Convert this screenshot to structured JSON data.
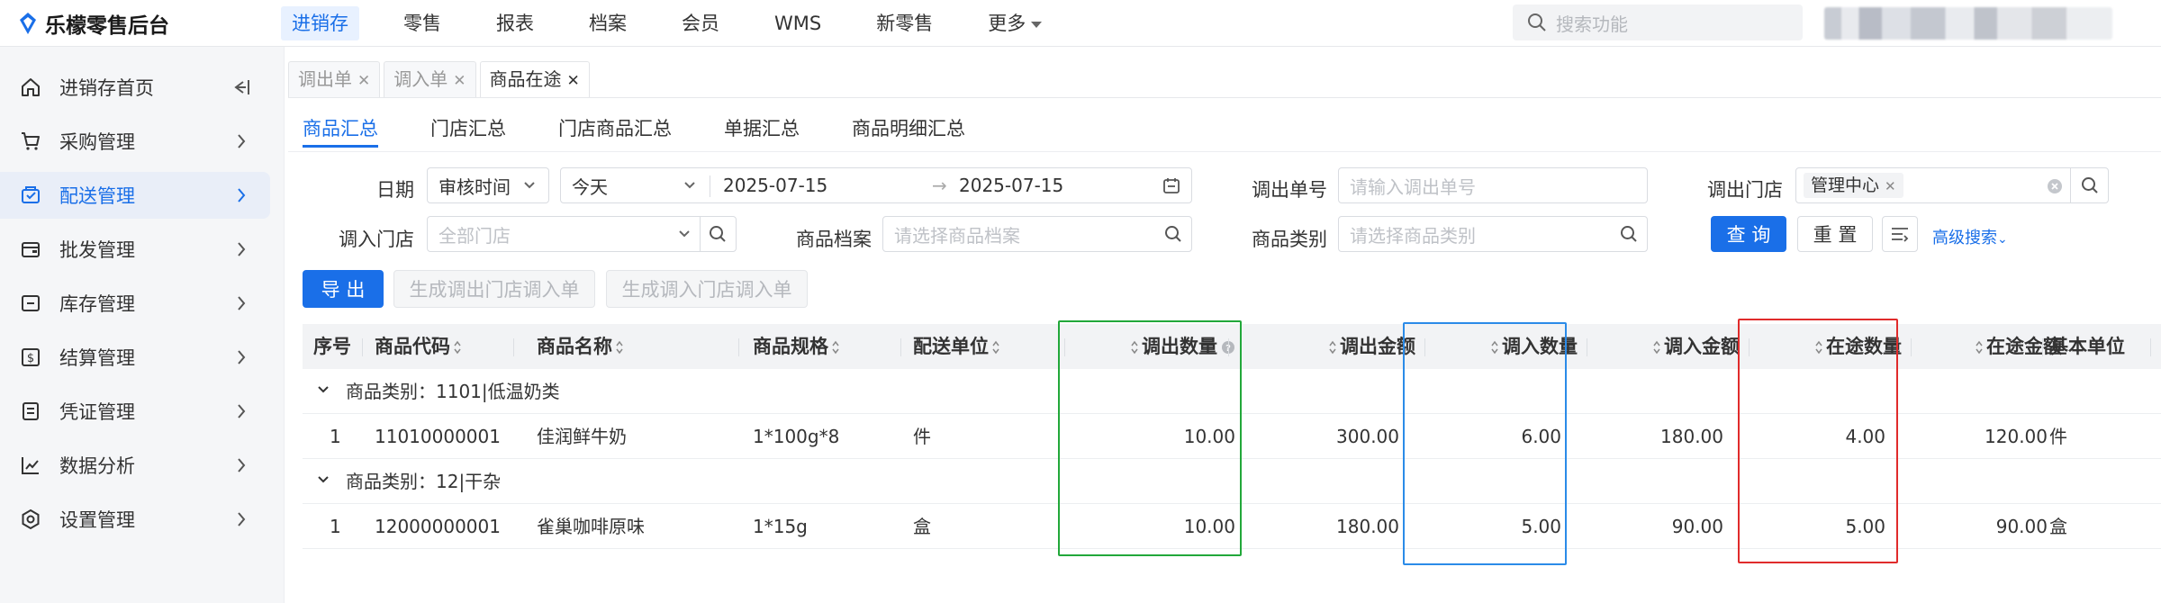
{
  "app": {
    "title": "乐檬零售后台",
    "brand_color": "#1a6fe8"
  },
  "topnav": {
    "items": [
      {
        "label": "进销存",
        "active": true
      },
      {
        "label": "零售"
      },
      {
        "label": "报表"
      },
      {
        "label": "档案"
      },
      {
        "label": "会员"
      },
      {
        "label": "WMS"
      },
      {
        "label": "新零售"
      },
      {
        "label": "更多"
      }
    ],
    "search_placeholder": "搜索功能"
  },
  "sidebar": {
    "items": [
      {
        "label": "进销存首页",
        "icon": "home-icon"
      },
      {
        "label": "采购管理",
        "icon": "cart-icon"
      },
      {
        "label": "配送管理",
        "icon": "delivery-icon",
        "active": true
      },
      {
        "label": "批发管理",
        "icon": "wallet-icon"
      },
      {
        "label": "库存管理",
        "icon": "inventory-icon"
      },
      {
        "label": "结算管理",
        "icon": "settlement-icon"
      },
      {
        "label": "凭证管理",
        "icon": "voucher-icon"
      },
      {
        "label": "数据分析",
        "icon": "chart-icon"
      },
      {
        "label": "设置管理",
        "icon": "settings-icon"
      }
    ]
  },
  "page_tabs": [
    {
      "label": "调出单",
      "active": false
    },
    {
      "label": "调入单",
      "active": false
    },
    {
      "label": "商品在途",
      "active": true
    }
  ],
  "sub_tabs": [
    {
      "label": "商品汇总",
      "active": true
    },
    {
      "label": "门店汇总"
    },
    {
      "label": "门店商品汇总"
    },
    {
      "label": "单据汇总"
    },
    {
      "label": "商品明细汇总"
    }
  ],
  "filters": {
    "date_label": "日期",
    "date_type": "审核时间",
    "date_range": "今天",
    "date_from": "2025-07-15",
    "date_to": "2025-07-15",
    "out_order_label": "调出单号",
    "out_order_placeholder": "请输入调出单号",
    "out_store_label": "调出门店",
    "out_store_tag": "管理中心",
    "in_store_label": "调入门店",
    "in_store_placeholder": "全部门店",
    "product_label": "商品档案",
    "product_placeholder": "请选择商品档案",
    "category_label": "商品类别",
    "category_placeholder": "请选择商品类别",
    "query_button": "查 询",
    "reset_button": "重 置",
    "advanced_link": "高级搜索"
  },
  "actions": {
    "export": "导 出",
    "gen_out": "生成调出门店调入单",
    "gen_in": "生成调入门店调入单"
  },
  "table": {
    "columns": [
      "序号",
      "商品代码",
      "商品名称",
      "商品规格",
      "配送单位",
      "调出数量",
      "调出金额",
      "调入数量",
      "调入金额",
      "在途数量",
      "在途金额",
      "基本单位"
    ],
    "groups": [
      {
        "label": "商品类别：1101|低温奶类",
        "rows": [
          {
            "no": "1",
            "code": "11010000001",
            "name": "佳润鲜牛奶",
            "spec": "1*100g*8",
            "unit": "件",
            "out_qty": "10.00",
            "out_amt": "300.00",
            "in_qty": "6.00",
            "in_amt": "180.00",
            "transit_qty": "4.00",
            "transit_amt": "120.00",
            "base_unit": "件"
          }
        ]
      },
      {
        "label": "商品类别：12|干杂",
        "rows": [
          {
            "no": "1",
            "code": "12000000001",
            "name": "雀巢咖啡原味",
            "spec": "1*15g",
            "unit": "盒",
            "out_qty": "10.00",
            "out_amt": "180.00",
            "in_qty": "5.00",
            "in_amt": "90.00",
            "transit_qty": "5.00",
            "transit_amt": "90.00",
            "base_unit": "盒"
          }
        ]
      }
    ]
  },
  "highlight_colors": {
    "out_qty": "#22a83a",
    "in_qty": "#2b8be8",
    "transit_qty": "#e02b2b"
  }
}
